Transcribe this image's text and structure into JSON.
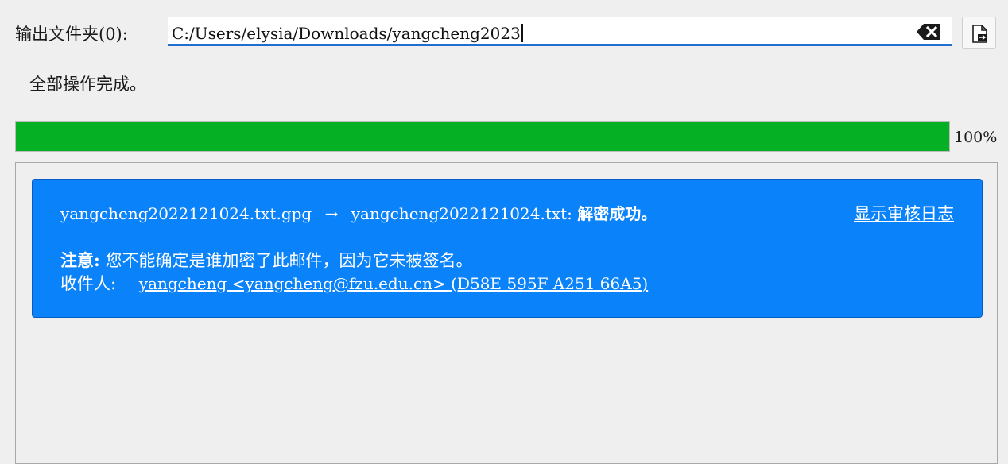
{
  "output": {
    "label": "输出文件夹(0):",
    "path_value": "C:/Users/elysia/Downloads/yangcheng2023",
    "clear_icon": "backspace-clear-icon",
    "browse_icon": "open-file-icon"
  },
  "status": {
    "message": "全部操作完成。"
  },
  "progress": {
    "value_percent": 100,
    "label": "100%",
    "fill_color": "#06b025"
  },
  "result": {
    "card_color": "#0a82fa",
    "source_file": "yangcheng2022121024.txt.gpg",
    "arrow": "→",
    "target_file": "yangcheng2022121024.txt:",
    "outcome": "解密成功。",
    "audit_link": "显示审核日志",
    "note_label": "注意:",
    "note_text": "您不能确定是谁加密了此邮件，因为它未被签名。",
    "recipient_label": "收件人:",
    "recipient_link": "yangcheng <yangcheng@fzu.edu.cn> (D58E 595F A251 66A5)"
  }
}
